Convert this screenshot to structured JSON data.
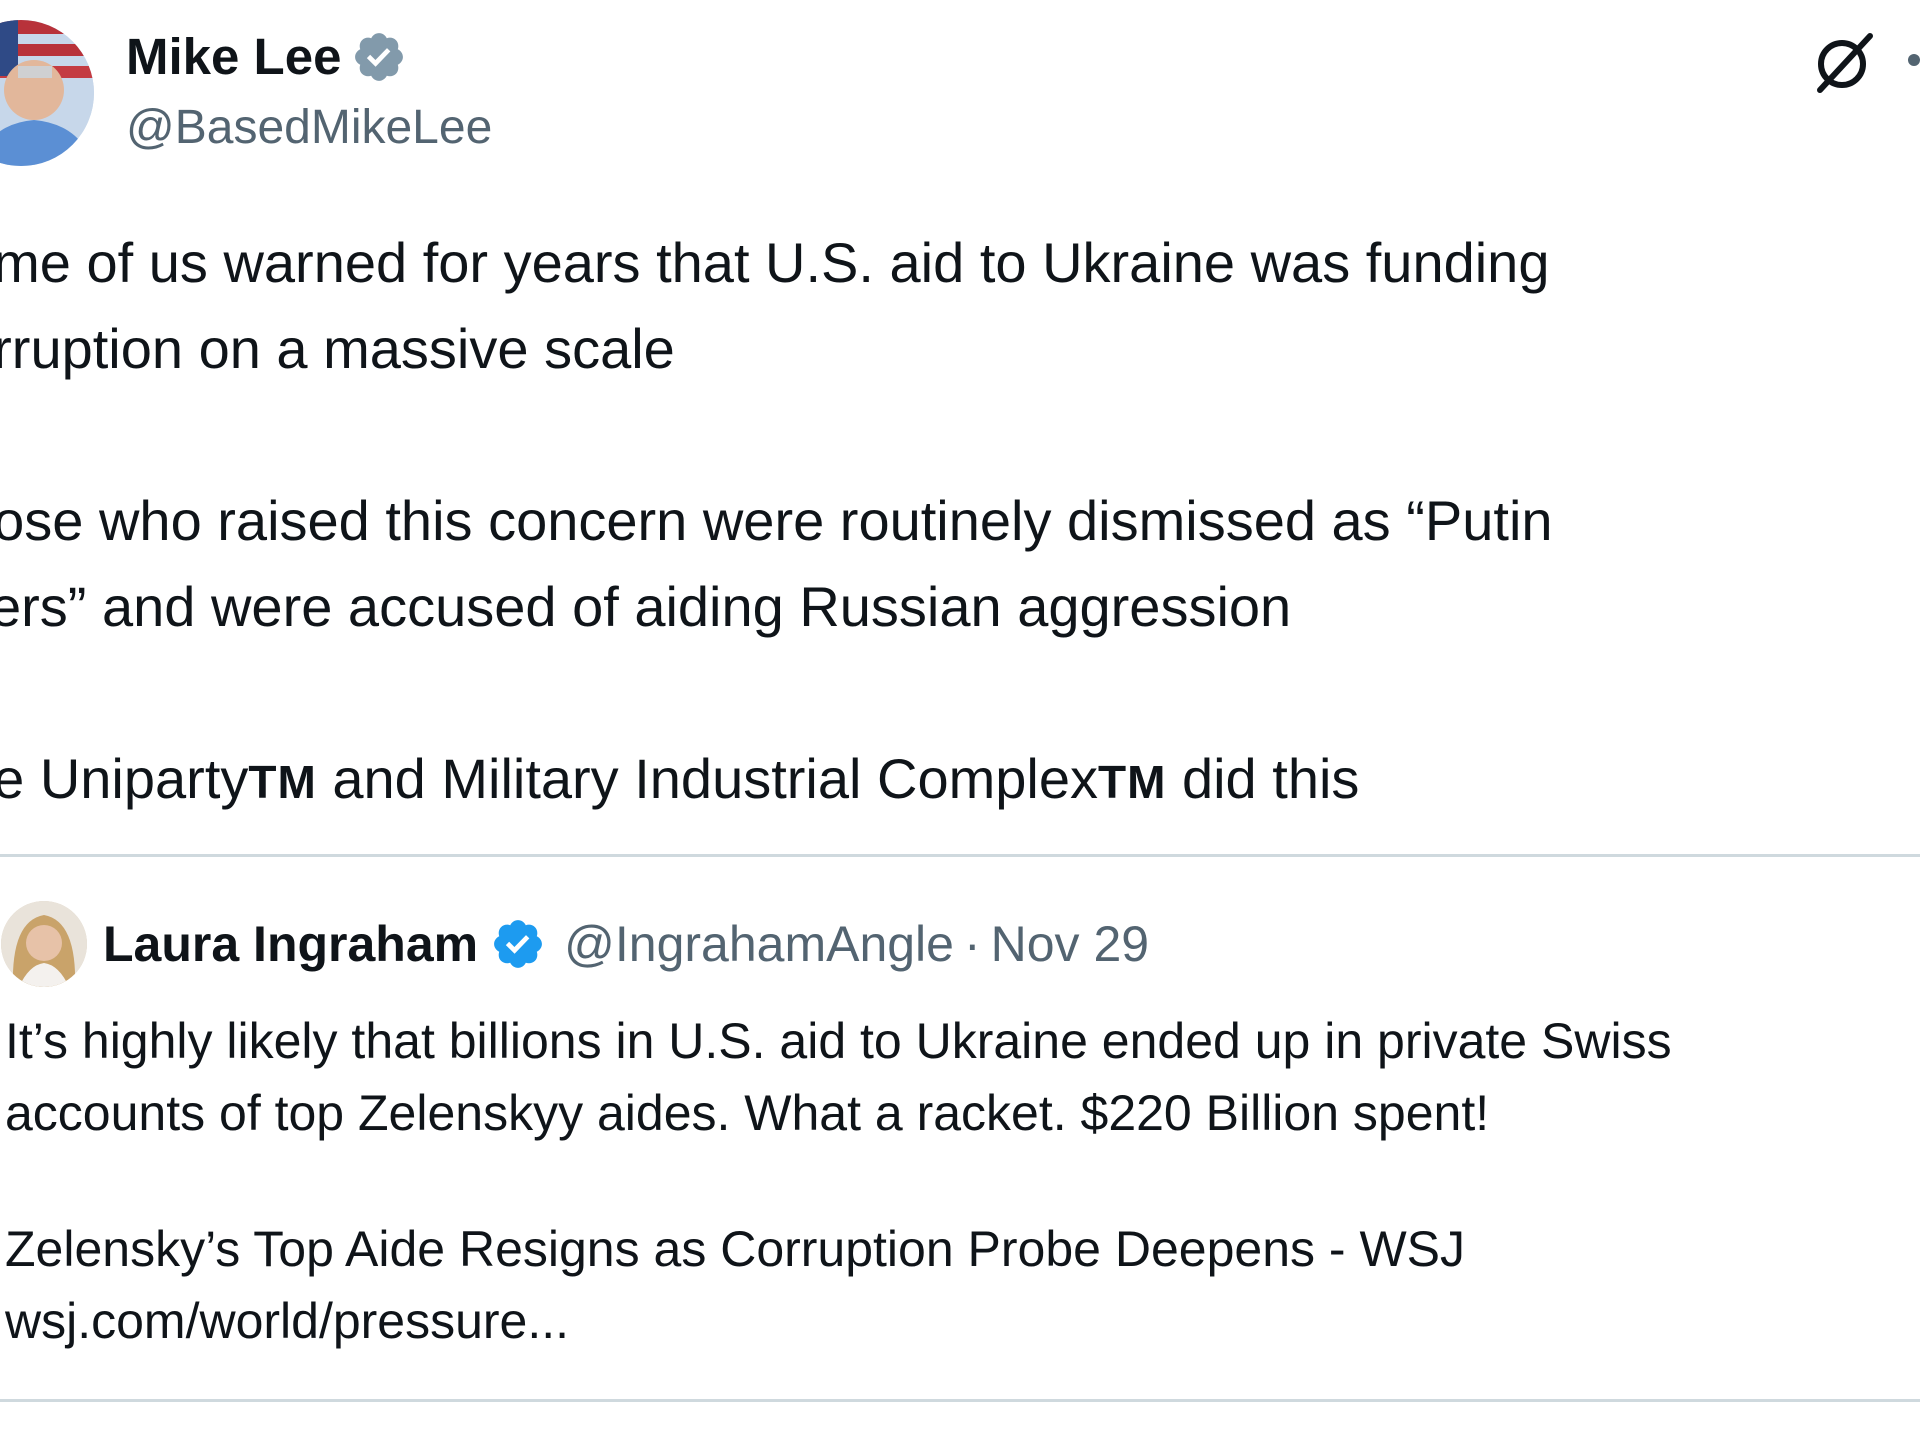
{
  "author": {
    "name": "Mike Lee",
    "handle": "@BasedMikeLee",
    "verified_icon": "verified-badge-icon",
    "verified_color": "#829aab"
  },
  "actions": {
    "grok_icon": "grok-icon",
    "more_icon": "more-icon"
  },
  "tweet": {
    "paragraph_1": "ome of us warned for years that U.S. aid to Ukraine was funding\norruption on a massive scale",
    "paragraph_2": "hose who raised this concern were routinely dismissed as “Putin\nvers” and were accused of aiding Russian aggression",
    "paragraph_3": {
      "part_1": "he Uniparty",
      "tm_1": "TM",
      "part_2": " and Military Industrial Complex",
      "tm_2": "TM",
      "part_3": " did this"
    }
  },
  "quoted_tweet": {
    "name": "Laura Ingraham",
    "handle": "@IngrahamAngle",
    "separator": "·",
    "date": "Nov 29",
    "verified_color": "#1d9bf0",
    "text_line_1": "It’s highly likely that billions in U.S. aid to Ukraine ended up in private Swiss",
    "text_line_2": "accounts of top Zelenskyy aides. What a racket. $220 Billion spent!",
    "link_title": "Zelensky’s Top Aide Resigns as Corruption Probe Deepens - WSJ",
    "link_url": "wsj.com/world/pressure..."
  },
  "colors": {
    "text": "#0f1419",
    "secondary": "#536471",
    "border": "#cfd9de"
  }
}
